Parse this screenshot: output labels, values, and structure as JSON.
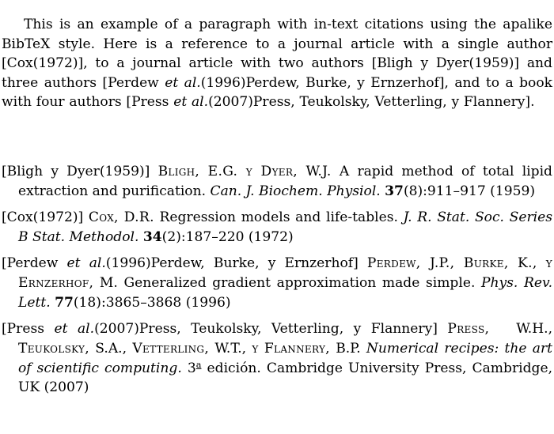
{
  "document": {
    "background_color": "#ffffff",
    "text_color": "#000000",
    "intro_paragraph": {
      "part1": "This is an example of a paragraph with in-text citations using the apalike BibTeX style. Here is a reference to a journal article with a single author [Cox(1972)], to a journal article with two authors [Bligh y Dyer(1959)] and three authors [Perdew ",
      "etal1": "et al.",
      "part2": "(1996)Perdew, Burke, y Ernzerhof], and to a book with four authors [Press ",
      "etal2": "et al.",
      "part3": "(2007)Press, Teukolsky, Vetterling, y Flannery]."
    },
    "bibliography": [
      {
        "id": "bligh-dyer-1959",
        "label": "[Bligh y Dyer(1959)]",
        "authors": "Bligh, E.G. y Dyer, W.J.",
        "title": "A rapid method of total lipid extraction and purification.",
        "journal": "Can. J. Biochem. Physiol.",
        "volume": "37",
        "issue": "(8)",
        "pages": ":911–917",
        "year": "(1959)"
      },
      {
        "id": "cox-1972",
        "label": "[Cox(1972)]",
        "authors": "Cox, D.R.",
        "title": "Regression models and life-tables.",
        "journal": "J. R. Stat. Soc. Series B Stat. Methodol.",
        "volume": "34",
        "issue": "(2)",
        "pages": ":187–220",
        "year": "(1972)"
      },
      {
        "id": "perdew-1996",
        "label_pre": "[Perdew ",
        "label_etal": "et al.",
        "label_post": "(1996)Perdew, Burke, y Ernzerhof]",
        "authors_a": "Perdew, J.P., Burke, K.,",
        "authors_b": "y Ernzerhof,",
        "authors_initial": "M.",
        "title": "Generalized gradient approximation made simple.",
        "journal": "Phys. Rev. Lett.",
        "volume": "77",
        "issue": "(18)",
        "pages": ":3865–3868",
        "year": "(1996)"
      },
      {
        "id": "press-2007",
        "label_pre": "[Press ",
        "label_etal": "et al.",
        "label_post": "(2007)Press, Teukolsky, Vetterling, y Flannery]",
        "authors_press": "Press,",
        "authors_press_initials": "W.H.,",
        "authors_teukolsky": "Teukolsky,",
        "authors_teukolsky_initials": "S.A.,",
        "authors_vetterling": "Vetterling,",
        "authors_vetterling_initials": "W.T.,",
        "authors_y": "y",
        "authors_flannery": "Flannery,",
        "authors_flannery_initials": "B.P.",
        "title": "Numerical recipes: the art of scientific computing.",
        "edition_number": "3",
        "edition_ordinal": "a",
        "edition_word": " edición.",
        "publisher": "Cambridge University Press, Cambridge, UK",
        "year": "(2007)"
      }
    ]
  }
}
